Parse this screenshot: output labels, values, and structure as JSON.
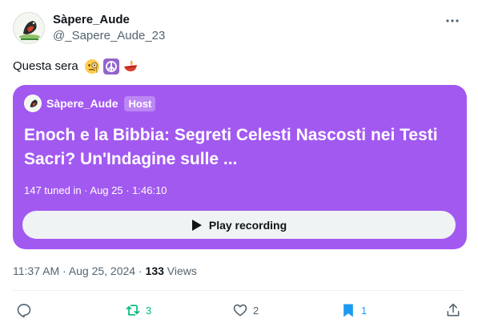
{
  "author": {
    "display_name": "Sàpere_Aude",
    "handle": "@_Sapere_Aude_23"
  },
  "tweet": {
    "text": "Questa sera",
    "emojis": [
      "monocle-face-emoji",
      "peace-symbol-emoji",
      "diya-lamp-emoji"
    ]
  },
  "space": {
    "host_name": "Sàpere_Aude",
    "host_badge": "Host",
    "title": "Enoch e la Bibbia: Segreti Celesti Nascosti nei Testi Sacri? Un'Indagine sulle ...",
    "meta": "147 tuned in · Aug 25 · 1:46:10",
    "play_label": "Play recording",
    "card_color": "#a259f0"
  },
  "timestamp": {
    "time_date": "11:37 AM · Aug 25, 2024 · ",
    "views_count": "133",
    "views_label": " Views"
  },
  "actions": {
    "reply_count": "",
    "retweet_count": "3",
    "like_count": "2",
    "bookmark_count": "1"
  },
  "colors": {
    "retweet_active": "#00ba7c",
    "bookmark_active": "#1d9bf0",
    "secondary_text": "#536471"
  }
}
